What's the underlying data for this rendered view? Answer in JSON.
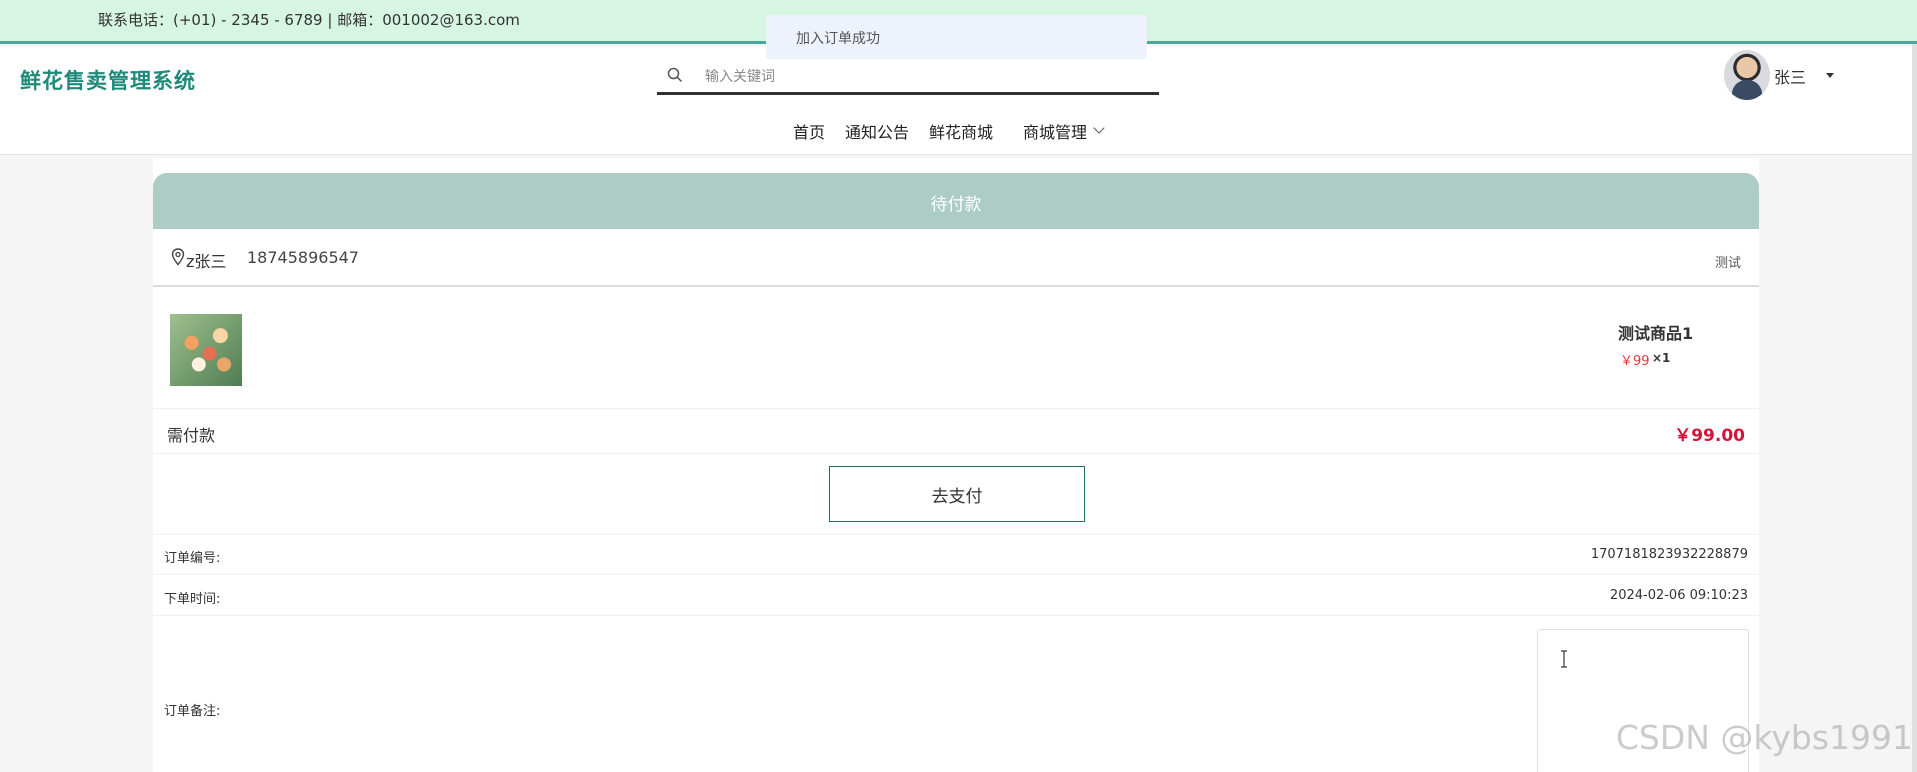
{
  "topbar": {
    "contact": "联系电话：(+01) - 2345 - 6789 | 邮箱：001002@163.com"
  },
  "toast": {
    "message": "加入订单成功"
  },
  "header": {
    "brand": "鲜花售卖管理系统",
    "search": {
      "placeholder": "输入关键词",
      "value": ""
    },
    "user": {
      "name": "张三"
    }
  },
  "nav": {
    "items": [
      {
        "label": "首页"
      },
      {
        "label": "通知公告"
      },
      {
        "label": "鲜花商城"
      },
      {
        "label": "商城管理"
      }
    ]
  },
  "order": {
    "status": "待付款",
    "address": {
      "name": "z张三",
      "phone": "18745896547",
      "note": "测试"
    },
    "goods": {
      "name": "测试商品1",
      "price": "￥99",
      "qty": "×1"
    },
    "payable_label": "需付款",
    "payable_amount": "￥99.00",
    "pay_button": "去支付",
    "order_no_label": "订单编号:",
    "order_no": "1707181823932228879",
    "order_time_label": "下单时间:",
    "order_time": "2024-02-06 09:10:23",
    "remark_label": "订单备注:",
    "remark_value": ""
  },
  "watermark": "CSDN @kybs1991",
  "colors": {
    "accent": "#1f8a7a",
    "status_bar": "#adcdc4",
    "price_red": "#d4143b",
    "topbar_bg": "#d6f5e3"
  }
}
